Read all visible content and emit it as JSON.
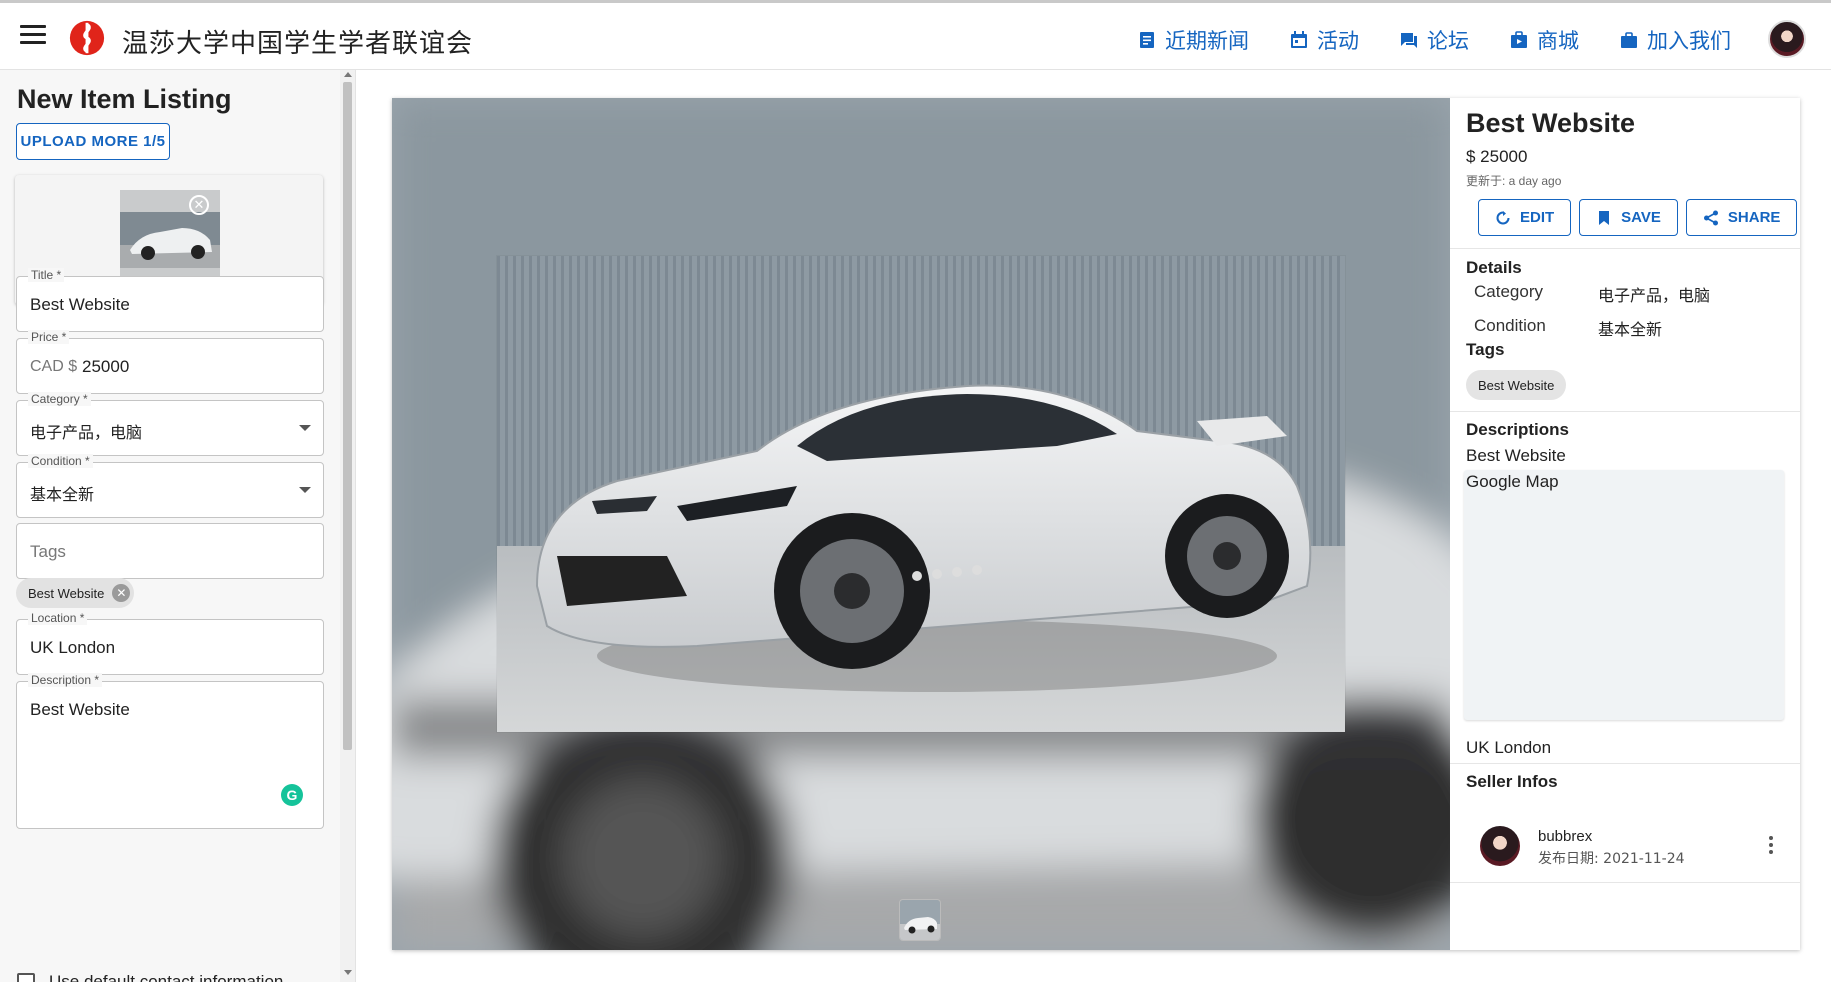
{
  "header": {
    "site_title": "温莎大学中国学生学者联谊会",
    "nav": [
      {
        "label": "近期新闻",
        "icon": "news-icon"
      },
      {
        "label": "活动",
        "icon": "calendar-icon"
      },
      {
        "label": "论坛",
        "icon": "forum-icon"
      },
      {
        "label": "商城",
        "icon": "store-icon"
      },
      {
        "label": "加入我们",
        "icon": "briefcase-icon"
      }
    ],
    "accent": "#1565c0"
  },
  "form": {
    "heading": "New Item Listing",
    "upload_label": "UPLOAD MORE 1/5",
    "title_label": "Title *",
    "title_value": "Best Website",
    "price_label": "Price *",
    "price_prefix": "CAD $",
    "price_value": "25000",
    "category_label": "Category *",
    "category_value": "电子产品，电脑",
    "condition_label": "Condition *",
    "condition_value": "基本全新",
    "tags_placeholder": "Tags",
    "tag_chip": "Best Website",
    "location_label": "Location *",
    "location_value": "UK London",
    "description_label": "Description *",
    "description_value": "Best Website",
    "contact_checkbox_label": "Use default contact information"
  },
  "preview": {
    "title": "Best Website",
    "price": "$ 25000",
    "updated": "更新于: a day ago",
    "actions": {
      "edit": "EDIT",
      "save": "SAVE",
      "share": "SHARE"
    },
    "details_heading": "Details",
    "category_key": "Category",
    "category_value": "电子产品，电脑",
    "condition_key": "Condition",
    "condition_value": "基本全新",
    "tags_heading": "Tags",
    "tag_chip": "Best Website",
    "descriptions_heading": "Descriptions",
    "description_text": "Best Website",
    "map_label": "Google Map",
    "location": "UK London",
    "seller_heading": "Seller Infos",
    "seller_name": "bubbrex",
    "seller_date": "发布日期:  2021-11-24"
  }
}
